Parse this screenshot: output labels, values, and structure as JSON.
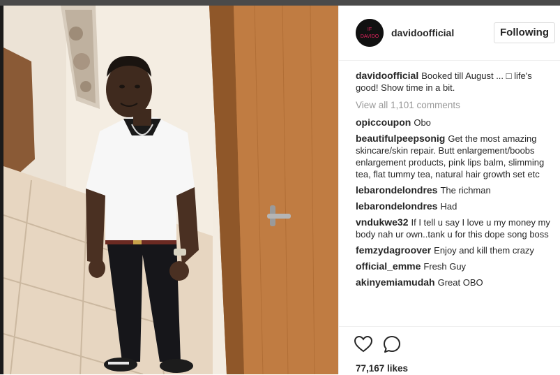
{
  "post": {
    "username": "davidoofficial",
    "follow_label": "Following",
    "avatar_text": "IF\nDAVIDO",
    "caption_user": "davidoofficial",
    "caption_text": "Booked till August ... □ life's good! Show time in a bit.",
    "view_all_comments": "View all 1,101 comments",
    "likes": "77,167 likes"
  },
  "comments": [
    {
      "user": "opiccoupon",
      "text": "Obo"
    },
    {
      "user": "beautifulpeepsonig",
      "text": "Get the most amazing skincare/skin repair. Butt enlargement/boobs enlargement products, pink lips balm, slimming tea, flat tummy tea, natural hair growth set etc"
    },
    {
      "user": "lebarondelondres",
      "text": "The richman"
    },
    {
      "user": "lebarondelondres",
      "text": "Had"
    },
    {
      "user": "vndukwe32",
      "text": "If I tell u say I love u my money my body nah ur own..tank u for this dope song boss"
    },
    {
      "user": "femzydagroover",
      "text": "Enjoy and kill them crazy"
    },
    {
      "user": "official_emme",
      "text": "Fresh Guy"
    },
    {
      "user": "akinyemiamudah",
      "text": "Great OBO"
    }
  ],
  "icons": {
    "like": "heart-icon",
    "comment": "speech-bubble-icon"
  },
  "colors": {
    "text": "#262626",
    "muted": "#999999",
    "border": "#dbdbdb",
    "avatar_text": "#e0245e"
  }
}
